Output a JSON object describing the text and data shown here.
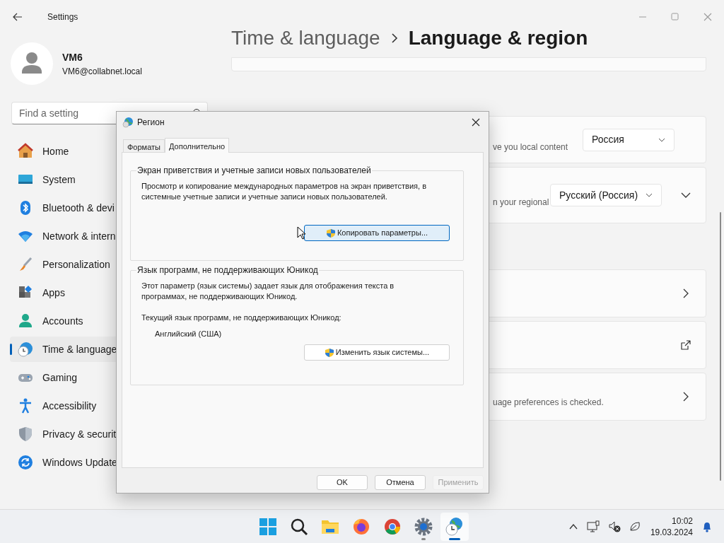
{
  "window": {
    "title": "Settings"
  },
  "user": {
    "name": "VM6",
    "email": "VM6@collabnet.local"
  },
  "search": {
    "placeholder": "Find a setting"
  },
  "nav": [
    {
      "kind": "home",
      "label": "Home",
      "selected": false
    },
    {
      "kind": "system",
      "label": "System",
      "selected": false
    },
    {
      "kind": "bluetooth",
      "label": "Bluetooth & devi",
      "selected": false
    },
    {
      "kind": "network",
      "label": "Network & intern",
      "selected": false
    },
    {
      "kind": "personalization",
      "label": "Personalization",
      "selected": false
    },
    {
      "kind": "apps",
      "label": "Apps",
      "selected": false
    },
    {
      "kind": "accounts",
      "label": "Accounts",
      "selected": false
    },
    {
      "kind": "time",
      "label": "Time & language",
      "selected": true
    },
    {
      "kind": "gaming",
      "label": "Gaming",
      "selected": false
    },
    {
      "kind": "accessibility",
      "label": "Accessibility",
      "selected": false
    },
    {
      "kind": "privacy",
      "label": "Privacy & securit",
      "selected": false
    },
    {
      "kind": "update",
      "label": "Windows Update",
      "selected": false
    }
  ],
  "breadcrumb": {
    "parent": "Time & language",
    "current": "Language & region"
  },
  "cards": [
    {
      "kind": "blank"
    },
    {
      "kind": "dropdown",
      "text": "ve you local content",
      "value": "Россия"
    },
    {
      "kind": "expander",
      "text": "n your regional",
      "value": "Русский (Россия)",
      "expanded": false
    },
    {
      "kind": "gap"
    },
    {
      "kind": "link"
    },
    {
      "kind": "external"
    },
    {
      "kind": "link",
      "text": "uage preferences is checked."
    }
  ],
  "dialog": {
    "title": "Регион",
    "tabs": [
      {
        "label": "Форматы",
        "selected": false
      },
      {
        "label": "Дополнительно",
        "selected": true
      }
    ],
    "groups": [
      {
        "title": "Экран приветствия и учетные записи новых пользователей",
        "text": "Просмотр и копирование международных параметров на экран приветствия, в системные учетные записи и учетные записи новых пользователей.",
        "button": "Копировать параметры...",
        "hovered": true
      },
      {
        "title": "Язык программ, не поддерживающих Юникод",
        "text": "Этот параметр (язык системы) задает язык для отображения текста в программах, не поддерживающих Юникод.",
        "current_label": "Текущий язык программ, не поддерживающих Юникод:",
        "current_value": "Английский (США)",
        "button": "Изменить язык системы...",
        "hovered": false
      }
    ],
    "buttons": [
      {
        "label": "OK",
        "disabled": false
      },
      {
        "label": "Отмена",
        "disabled": false
      },
      {
        "label": "Применить",
        "disabled": true
      }
    ]
  },
  "taskbar": {
    "apps": [
      {
        "kind": "start",
        "active": false,
        "running": false
      },
      {
        "kind": "search",
        "active": false,
        "running": false
      },
      {
        "kind": "explorer",
        "active": false,
        "running": false
      },
      {
        "kind": "firefox",
        "active": false,
        "running": false
      },
      {
        "kind": "chrome",
        "active": false,
        "running": false
      },
      {
        "kind": "settings",
        "active": false,
        "running": true
      },
      {
        "kind": "region",
        "active": true,
        "running": true
      }
    ],
    "time": "10:02",
    "date": "19.03.2024"
  }
}
